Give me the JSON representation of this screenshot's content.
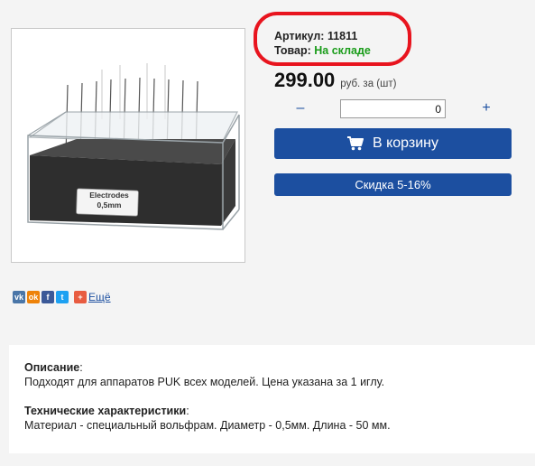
{
  "product": {
    "image_label": [
      "Electrodes",
      "0,5mm"
    ],
    "sku_label": "Артикул:",
    "sku_value": "11811",
    "stock_label": "Товар:",
    "stock_value": "На складе",
    "price": "299.00",
    "price_unit": "руб. за (шт)"
  },
  "quantity": {
    "minus": "–",
    "plus": "+",
    "value": "0"
  },
  "buttons": {
    "cart": "В корзину",
    "discount": "Скидка 5-16%"
  },
  "share": {
    "vk": "vk",
    "ok": "ok",
    "fb": "f",
    "tw": "t",
    "plus": "+",
    "more": "Ещё"
  },
  "description": {
    "title": "Описание",
    "text": "Подходят для аппаратов PUK всех моделей. Цена указана за 1 иглу.",
    "specs_title": "Технические характеристики",
    "specs_text": "Материал - специальный вольфрам. Диаметр - 0,5мм. Длина - 50 мм."
  },
  "colors": {
    "accent": "#1c4fa0",
    "stock": "#1a9c1a",
    "highlight": "#e8141e"
  }
}
